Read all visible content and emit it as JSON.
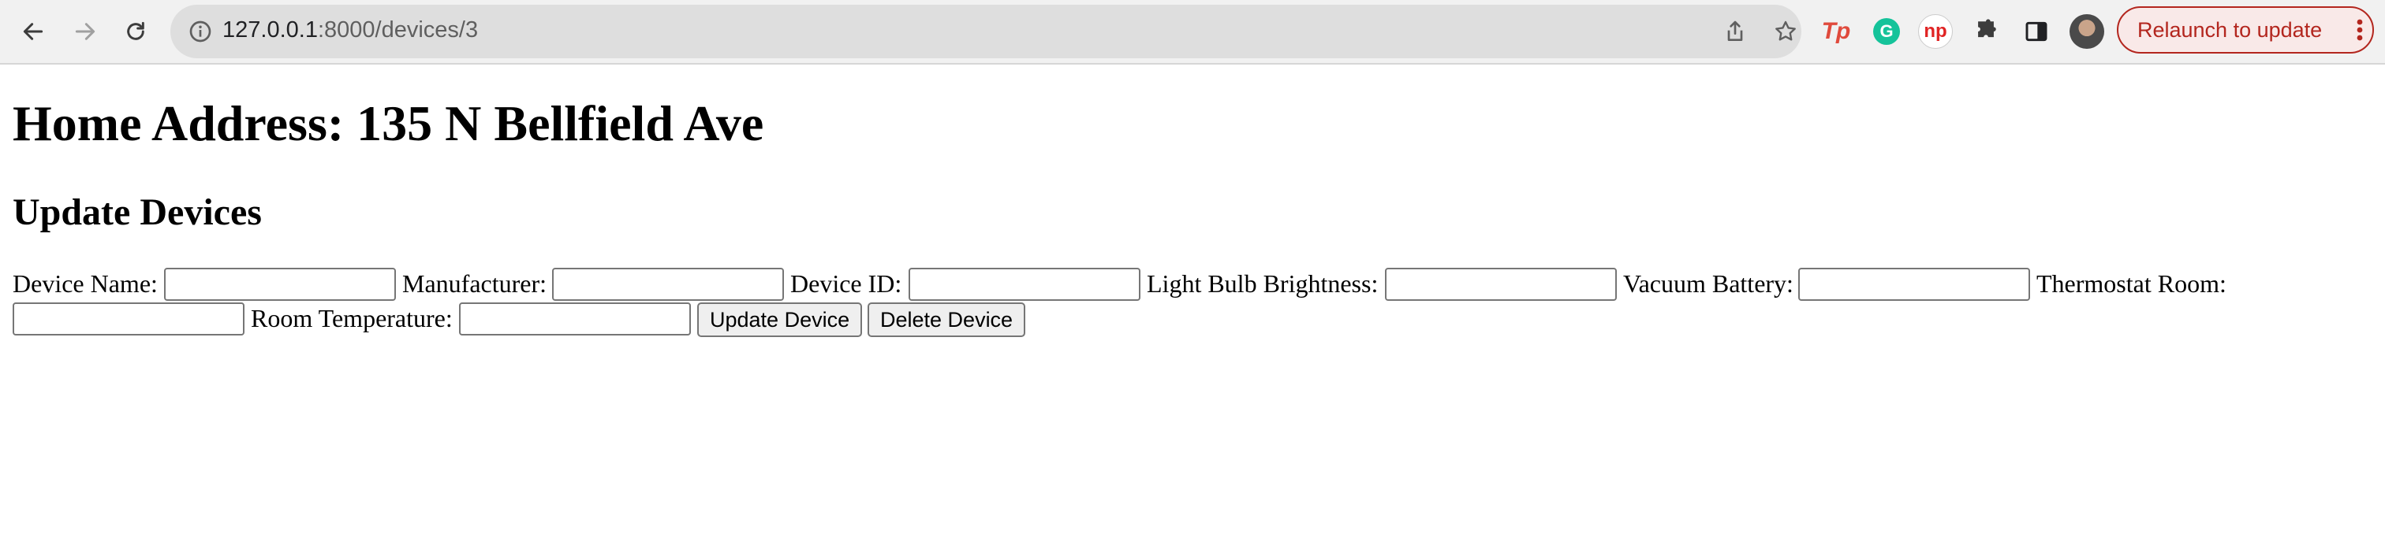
{
  "browser": {
    "url_host": "127.0.0.1",
    "url_path": ":8000/devices/3",
    "relaunch_label": "Relaunch to update",
    "extensions": [
      "Tp",
      "G",
      "np"
    ]
  },
  "page": {
    "title": "Home Address: 135 N Bellfield Ave",
    "subtitle": "Update Devices"
  },
  "form": {
    "device_name_label": "Device Name:",
    "manufacturer_label": "Manufacturer:",
    "device_id_label": "Device ID:",
    "brightness_label": "Light Bulb Brightness:",
    "vacuum_battery_label": "Vacuum Battery:",
    "thermostat_room_label": "Thermostat Room:",
    "room_temperature_label": "Room Temperature:",
    "device_name_value": "",
    "manufacturer_value": "",
    "device_id_value": "",
    "brightness_value": "",
    "vacuum_battery_value": "",
    "thermostat_room_value": "",
    "room_temperature_value": "",
    "update_button": "Update Device",
    "delete_button": "Delete Device"
  }
}
